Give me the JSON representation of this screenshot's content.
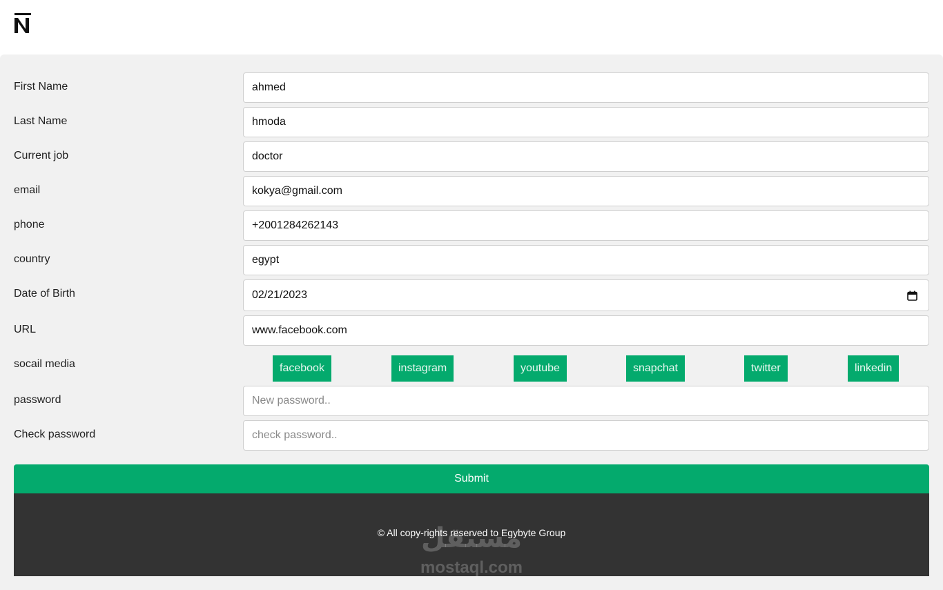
{
  "brand": {
    "logo_icon": "n-logo-icon"
  },
  "form": {
    "fields": [
      {
        "label": "First Name",
        "value": "ahmed"
      },
      {
        "label": "Last Name",
        "value": "hmoda"
      },
      {
        "label": "Current job",
        "value": "doctor"
      },
      {
        "label": "email",
        "value": "kokya@gmail.com"
      },
      {
        "label": "phone",
        "value": "+2001284262143"
      },
      {
        "label": "country",
        "value": "egypt"
      },
      {
        "label": "Date of Birth",
        "value": "02/21/2023"
      },
      {
        "label": "URL",
        "value": "www.facebook.com"
      }
    ],
    "social": {
      "label": "socail media",
      "buttons": [
        "facebook",
        "instagram",
        "youtube",
        "snapchat",
        "twitter",
        "linkedin"
      ]
    },
    "password": {
      "label": "password",
      "placeholder": "New password.."
    },
    "check_password": {
      "label": "Check password",
      "placeholder": "check password.."
    },
    "submit_label": "Submit"
  },
  "footer": {
    "copyright": "© All copy-rights reserved to Egybyte Group",
    "watermark_ar": "مستقل",
    "watermark_en": "mostaql.com"
  },
  "colors": {
    "accent": "#04aa6d",
    "footer_bg": "#333333",
    "panel_bg": "#f1f1f1"
  }
}
